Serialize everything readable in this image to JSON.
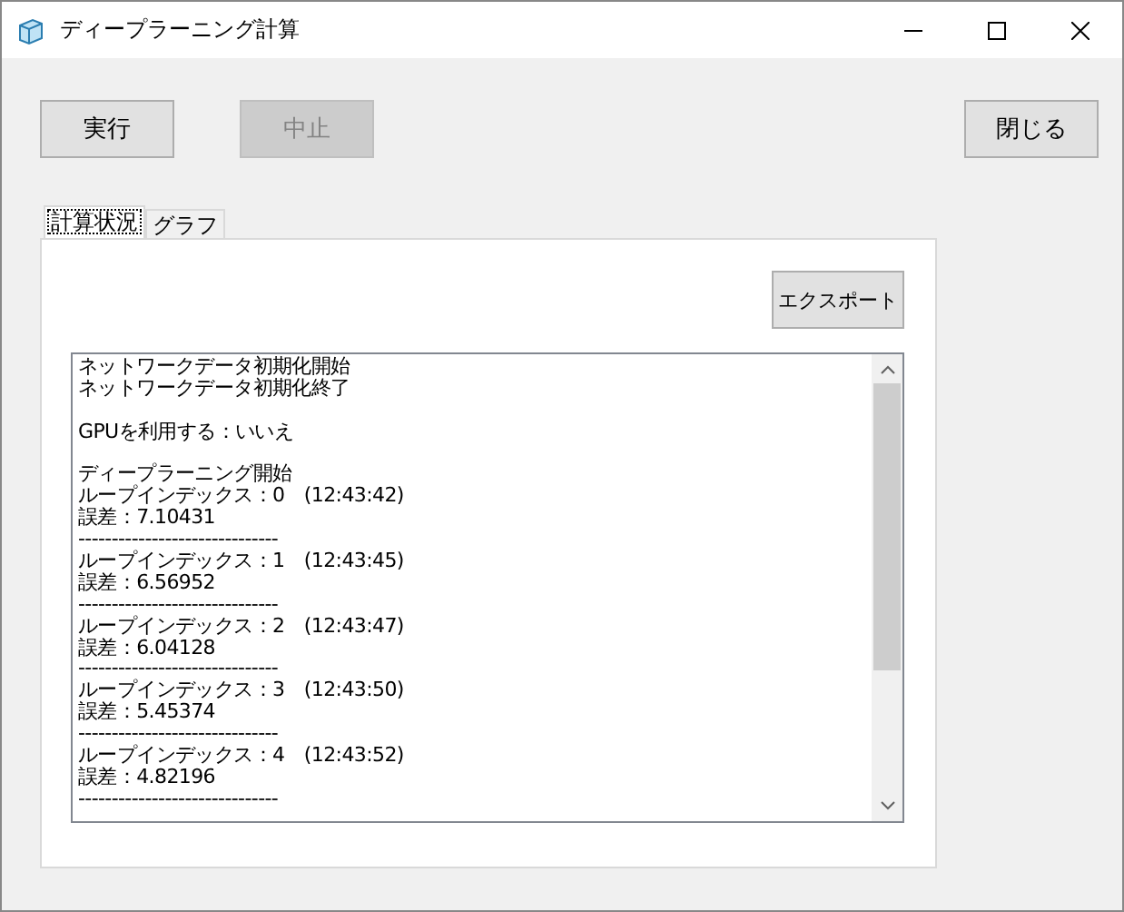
{
  "window": {
    "title": "ディープラーニング計算"
  },
  "buttons": [
    {
      "label": "実行",
      "disabled": false
    },
    {
      "label": "中止",
      "disabled": true
    },
    {
      "label": "閉じる",
      "disabled": false
    }
  ],
  "tabs": [
    {
      "label": "計算状況",
      "selected": true
    },
    {
      "label": "グラフ",
      "selected": false
    }
  ],
  "export_button": "エクスポート",
  "log_blocks": [
    [
      "ネットワークデータ初期化開始",
      "ネットワークデータ初期化終了"
    ],
    [
      "GPUを利用する：いいえ"
    ],
    [
      "ディープラーニング開始",
      "ループインデックス：0　(12:43:42)",
      "誤差：7.10431",
      "------------------------------",
      "ループインデックス：1　(12:43:45)",
      "誤差：6.56952",
      "------------------------------",
      "ループインデックス：2　(12:43:47)",
      "誤差：6.04128",
      "------------------------------",
      "ループインデックス：3　(12:43:50)",
      "誤差：5.45374",
      "------------------------------",
      "ループインデックス：4　(12:43:52)",
      "誤差：4.82196",
      "------------------------------"
    ]
  ]
}
